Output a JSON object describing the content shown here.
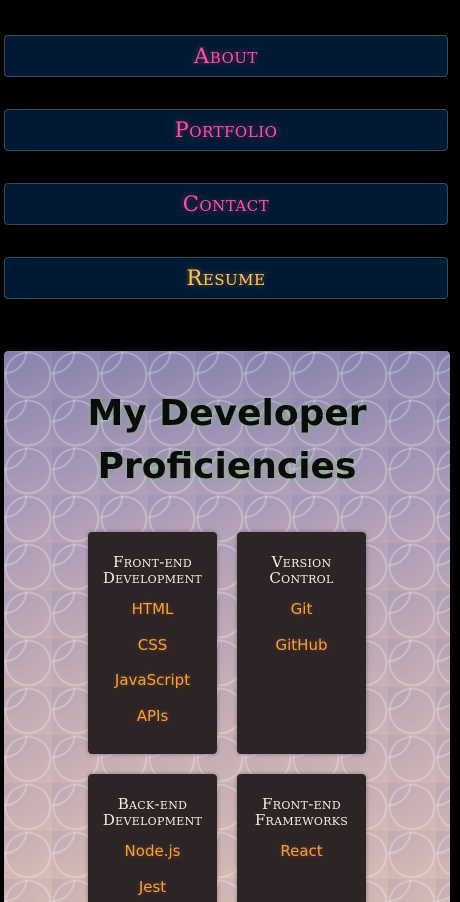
{
  "nav": {
    "about": "About",
    "portfolio": "Portfolio",
    "contact": "Contact",
    "resume": "Resume"
  },
  "proficiencies": {
    "title_line1": "My Developer",
    "title_line2": "Proficiencies",
    "cards": [
      {
        "heading_line1": "Front-end",
        "heading_line2": "Development",
        "items": [
          "HTML",
          "CSS",
          "JavaScript",
          "APIs"
        ]
      },
      {
        "heading_line1": "Version",
        "heading_line2": "Control",
        "items": [
          "Git",
          "GitHub"
        ]
      },
      {
        "heading_line1": "Back-end",
        "heading_line2": "Development",
        "items": [
          "Node.js",
          "Jest"
        ]
      },
      {
        "heading_line1": "Front-end",
        "heading_line2": "Frameworks",
        "items": [
          "React"
        ]
      }
    ]
  },
  "colors": {
    "nav_background": "#001a33",
    "nav_text": "#ff4fa3",
    "resume_text": "#ffc85a",
    "card_background": "#2d2426",
    "card_item_text": "#f2a33a"
  }
}
